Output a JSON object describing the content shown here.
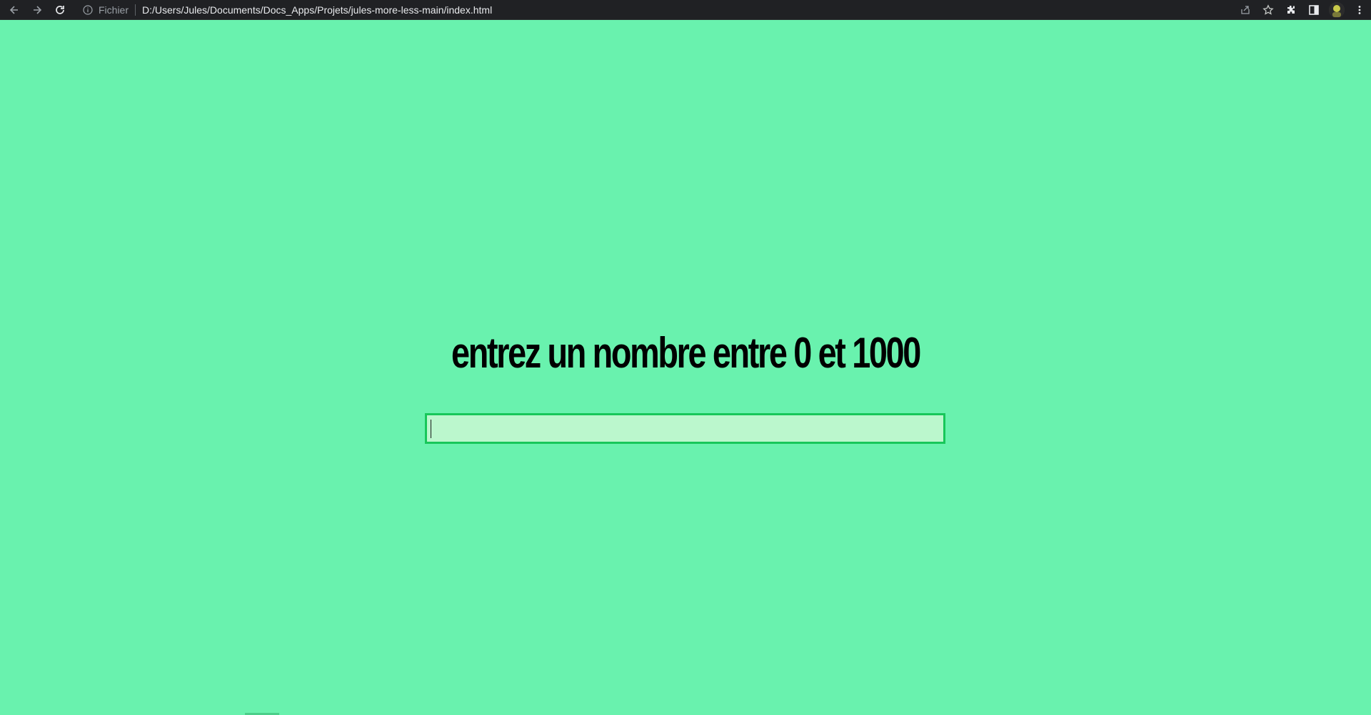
{
  "browser": {
    "scheme_label": "Fichier",
    "url": "D:/Users/Jules/Documents/Docs_Apps/Projets/jules-more-less-main/index.html",
    "icons": [
      "back-arrow-icon",
      "forward-arrow-icon",
      "reload-icon",
      "info-icon",
      "share-icon",
      "star-icon",
      "extensions-icon",
      "side-panel-icon",
      "profile-avatar",
      "menu-kebab-icon"
    ]
  },
  "page": {
    "background": "#69f2ae",
    "heading": "entrez un nombre entre 0 et 1000",
    "input": {
      "value": "",
      "placeholder": "",
      "border_color": "#17c75a",
      "background": "#bbf7cd"
    }
  }
}
